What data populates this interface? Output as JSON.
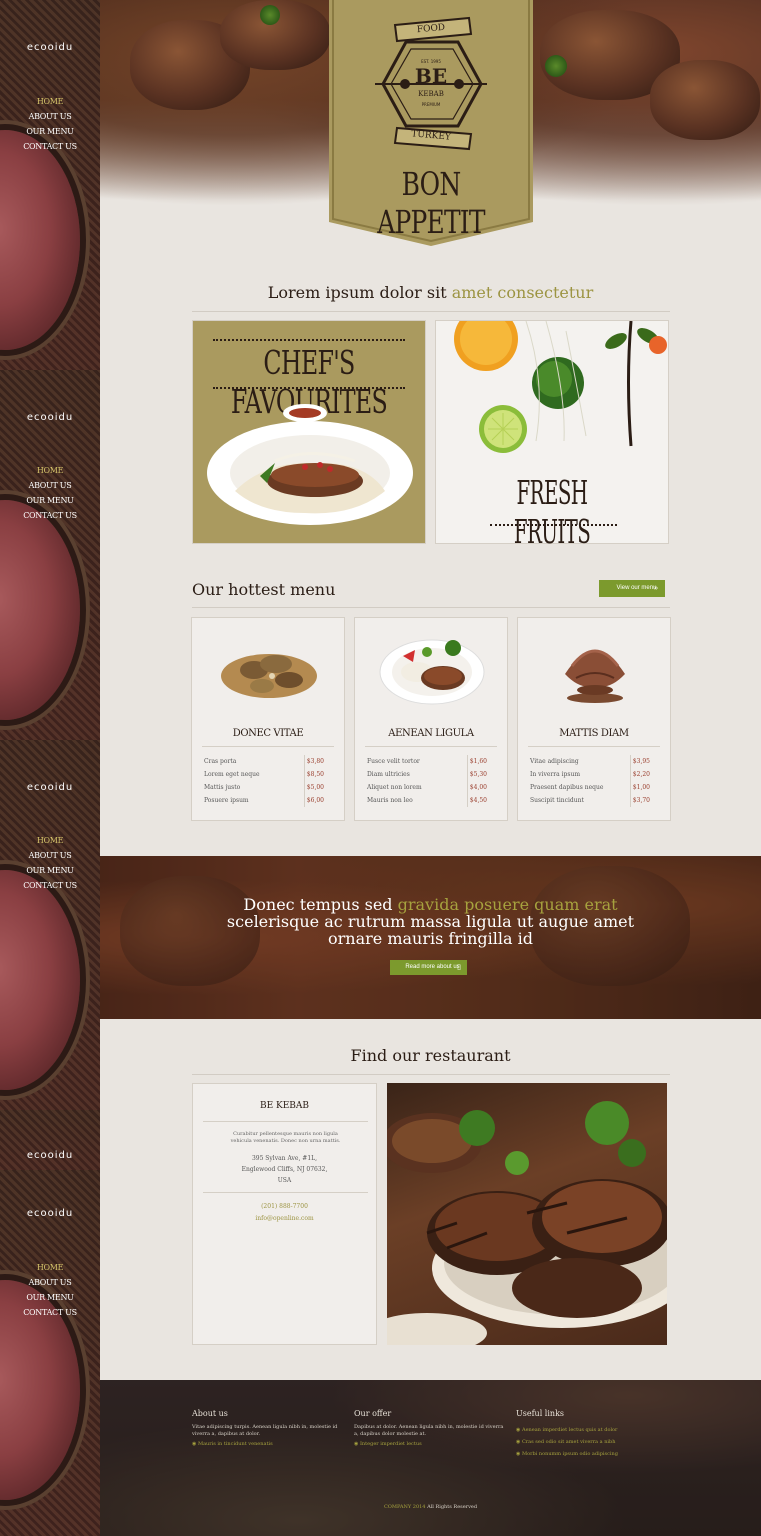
{
  "sidebar": {
    "logo": "ecooidu",
    "nav": [
      {
        "label": "Home",
        "active": true
      },
      {
        "label": "About us"
      },
      {
        "label": "Our menu"
      },
      {
        "label": "Contact us"
      }
    ]
  },
  "hero": {
    "badge_top": "FOOD",
    "badge_est": "EST. 1995",
    "badge_mark": "BE",
    "badge_kebab": "KEBAB",
    "badge_premium": "PREMIUM",
    "badge_bottom": "TURKEY",
    "tagline": "BON APPETIT"
  },
  "intro": {
    "title_main": "Lorem ipsum dolor sit ",
    "title_accent": "amet consectetur"
  },
  "features": {
    "chef_title": "CHEF'S FAVOURITES",
    "fruits_title": "FRESH FRUITS"
  },
  "menu": {
    "title": "Our hottest menu",
    "button_label": "View our menu",
    "cards": [
      {
        "name": "Donec vitae",
        "items": [
          {
            "label": "Cras porta",
            "price": "$3,80"
          },
          {
            "label": "Lorem eget neque",
            "price": "$8,50"
          },
          {
            "label": "Mattis justo",
            "price": "$5,00"
          },
          {
            "label": "Posuere ipsum",
            "price": "$6,00"
          }
        ]
      },
      {
        "name": "Aenean ligula",
        "items": [
          {
            "label": "Fusce velit tortor",
            "price": "$1,60"
          },
          {
            "label": "Diam ultricies",
            "price": "$5,30"
          },
          {
            "label": "Aliquet non lorem",
            "price": "$4,00"
          },
          {
            "label": "Mauris non leo",
            "price": "$4,50"
          }
        ]
      },
      {
        "name": "Mattis diam",
        "items": [
          {
            "label": "Vitae adipiscing",
            "price": "$3,95"
          },
          {
            "label": "In viverra ipsum",
            "price": "$2,20"
          },
          {
            "label": "Praesent dapibus neque",
            "price": "$1,00"
          },
          {
            "label": "Suscipit tincidunt",
            "price": "$3,70"
          }
        ]
      }
    ]
  },
  "banner": {
    "line1_main": "Donec tempus sed ",
    "line1_accent": "gravida posuere quam erat",
    "line2": "scelerisque ac rutrum massa ligula ut augue amet",
    "line3": "ornare mauris fringilla id",
    "button_label": "Read more about us"
  },
  "find": {
    "title": "Find our restaurant",
    "name": "BE KEBAB",
    "description": "Curabitur pellentesque mauris non ligula vehicula venenatis. Donec non urna mattis.",
    "address1": "395 Sylvan Ave, #1L,",
    "address2": "Englewood Cliffs, NJ 07632,",
    "address3": "USA",
    "phone": "(201) 888-7700",
    "email": "info@openline.com"
  },
  "footer": {
    "about_title": "About us",
    "about_text": "Vitae adipiscing turpis. Aenean ligula nibh in, molestie id viverra a, dapibus at dolor.",
    "about_link": "Mauris in tincidunt venenatis",
    "offer_title": "Our offer",
    "offer_text": "Dapibus at dolor. Aenean ligula nibh in, molestie id viverra a, dapibus dolor molestie at.",
    "offer_link": "Integer imperdiet lectus",
    "links_title": "Useful links",
    "links": [
      "Aenean imperdiet lectus quis at dolor",
      "Cras sed odio sit amet viverra a nibh",
      "Morbi nonumm ipsum odio adipiscing"
    ],
    "copyright_brand": "COMPANY 2014",
    "copyright_text": " All Rights Reserved"
  }
}
